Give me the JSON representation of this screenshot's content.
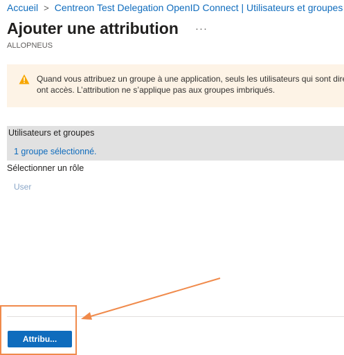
{
  "breadcrumb": {
    "items": [
      {
        "label": "Accueil"
      },
      {
        "label": "Centreon Test Delegation OpenID Connect | Utilisateurs et groupes"
      }
    ],
    "separator": ">"
  },
  "page": {
    "title": "Ajouter une attribution",
    "more_icon": "ellipsis-icon",
    "subtitle": "ALLOPNEUS"
  },
  "warning": {
    "icon": "warning-icon",
    "line1": "Quand vous attribuez un groupe à une application, seuls les utilisateurs qui sont direct",
    "line2": "ont accès. L’attribution ne s’applique pas aux groupes imbriqués."
  },
  "users_groups": {
    "label": "Utilisateurs et groupes",
    "value": "1 groupe sélectionné."
  },
  "role": {
    "label": "Sélectionner un rôle",
    "value": "User"
  },
  "footer": {
    "assign_label": "Attribu..."
  },
  "colors": {
    "accent": "#0f6cbd",
    "warning_bg": "#fdf3e6",
    "warning_icon": "#f7a600",
    "section_bg": "#e1e1e1",
    "annotation": "#f08a4b"
  }
}
